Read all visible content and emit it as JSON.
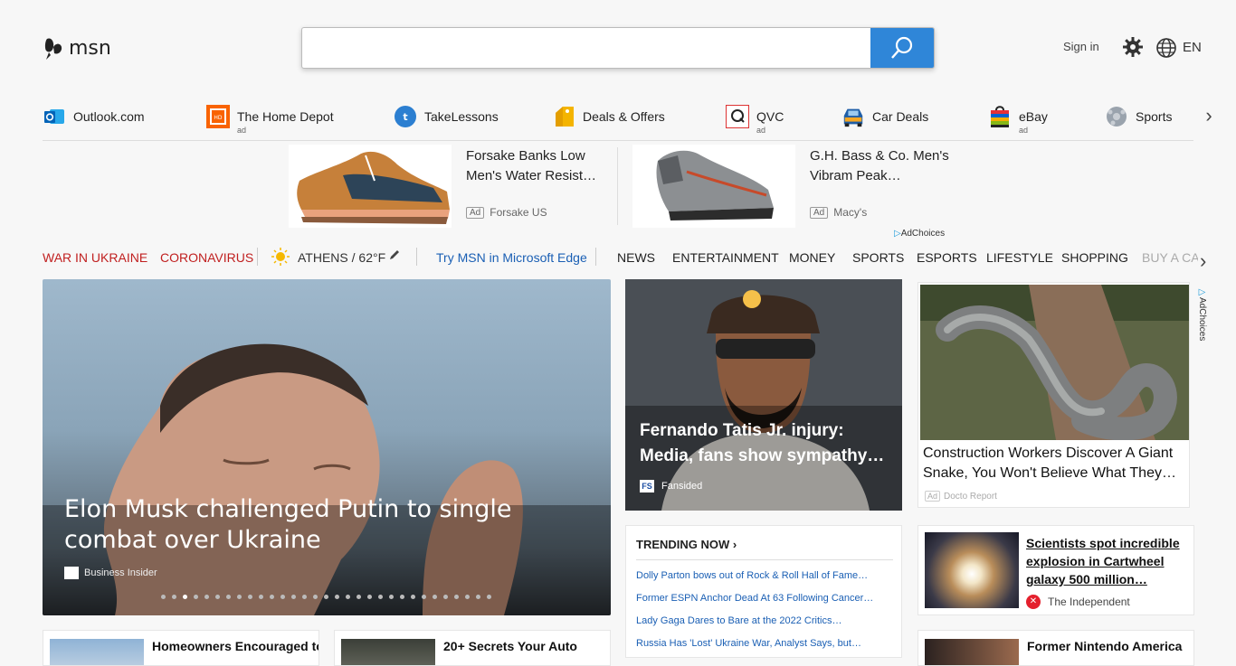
{
  "header": {
    "brand": "msn",
    "search_placeholder": "",
    "signin": "Sign in",
    "lang": "EN",
    "accent": "#2f86d8"
  },
  "quick_links": [
    {
      "label": "Outlook.com",
      "icon": "outlook-icon",
      "ad": ""
    },
    {
      "label": "The Home Depot",
      "icon": "home-depot-icon",
      "ad": "ad"
    },
    {
      "label": "TakeLessons",
      "icon": "takelessons-icon",
      "ad": ""
    },
    {
      "label": "Deals & Offers",
      "icon": "tag-icon",
      "ad": ""
    },
    {
      "label": "QVC",
      "icon": "qvc-icon",
      "ad": "ad"
    },
    {
      "label": "Car Deals",
      "icon": "car-icon",
      "ad": ""
    },
    {
      "label": "eBay",
      "icon": "shopping-bag-icon",
      "ad": "ad"
    },
    {
      "label": "Sports",
      "icon": "sports-icon",
      "ad": ""
    }
  ],
  "ads": [
    {
      "title": "Forsake Banks Low Men's Water Resist…",
      "tag": "Ad",
      "source": "Forsake US"
    },
    {
      "title": "G.H. Bass & Co. Men's Vibram Peak…",
      "tag": "Ad",
      "source": "Macy's"
    }
  ],
  "adchoices": "AdChoices",
  "nav": {
    "war": "WAR IN UKRAINE",
    "corona": "CORONAVIRUS",
    "weather": "ATHENS / 62°F",
    "edge": "Try MSN in Microsoft Edge",
    "items": [
      "NEWS",
      "ENTERTAINMENT",
      "MONEY",
      "SPORTS",
      "ESPORTS",
      "LIFESTYLE",
      "SHOPPING",
      "BUY A CA"
    ]
  },
  "hero": {
    "title": "Elon Musk challenged Putin to single combat over Ukraine",
    "source": "Business Insider",
    "dots_total": 31,
    "dot_active": 2
  },
  "card2": {
    "title": "Fernando Tatis Jr. injury: Media, fans show sympathy…",
    "source": "Fansided",
    "logo": "FS"
  },
  "card3": {
    "title": "Construction Workers Discover A Giant Snake, You Won't Believe What They…",
    "tag": "Ad",
    "source": "Docto Report"
  },
  "trending": {
    "heading": "TRENDING NOW ›",
    "items": [
      "Dolly Parton bows out of Rock & Roll Hall of Fame…",
      "Former ESPN Anchor Dead At 63 Following Cancer…",
      "Lady Gaga Dares to Bare at the 2022 Critics…",
      "Russia Has 'Lost' Ukraine War, Analyst Says, but…"
    ]
  },
  "card4": {
    "title": "Scientists spot incredible explosion in Cartwheel galaxy 500 million…",
    "source": "The Independent"
  },
  "bottom": [
    {
      "title": "Homeowners Encouraged to"
    },
    {
      "title": "20+ Secrets Your Auto"
    },
    {
      "title": "Former Nintendo America"
    }
  ]
}
